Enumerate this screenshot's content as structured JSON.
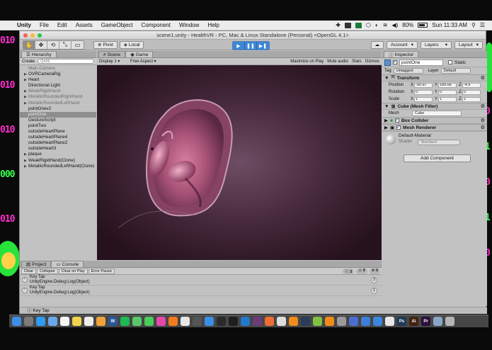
{
  "wallpaper": {
    "left_digits": [
      "010",
      "010",
      "010",
      "000",
      "010",
      "010"
    ],
    "right_digits": [
      "0",
      "1",
      "0",
      "1",
      "0"
    ],
    "left_colors": [
      "#ff2fd0",
      "#ff2fd0",
      "#ff2fd0",
      "#39ff4b",
      "#ff2fd0",
      "#ff2fd0"
    ]
  },
  "menubar": {
    "apple": "",
    "items": [
      "Unity",
      "File",
      "Edit",
      "Assets",
      "GameObject",
      "Component",
      "Window",
      "Help"
    ],
    "battery": "80%",
    "clock": "Sun 11:33 AM"
  },
  "window": {
    "title": "scene1.unity - HealthVR - PC, Mac & Linux Standalone (Personal) <OpenGL 4.1>"
  },
  "toolbar": {
    "tools": [
      "✋",
      "✥",
      "⟲",
      "⤡",
      "▭"
    ],
    "pivot": "Pivot",
    "local": "Local",
    "play": "▶",
    "pause": "❚❚",
    "step": "▶❚",
    "cloud": "☁",
    "account": "Account",
    "layers": "Layers",
    "layout": "Layout"
  },
  "hierarchy": {
    "tab": "Hierarchy",
    "create": "Create",
    "search_placeholder": "Q▾All",
    "items": [
      {
        "label": "Main Camera",
        "dim": true,
        "arrow": ""
      },
      {
        "label": "OVRCameraRig",
        "dim": false,
        "arrow": "▶"
      },
      {
        "label": "Heart",
        "dim": false,
        "arrow": "▶"
      },
      {
        "label": "Directional Light",
        "dim": false,
        "arrow": ""
      },
      {
        "label": "WeakRigidHand",
        "dim": true,
        "arrow": "▶"
      },
      {
        "label": "MetallicRoundedRightHand",
        "dim": true,
        "arrow": "▶"
      },
      {
        "label": "MetallicRoundedLeftHand",
        "dim": true,
        "arrow": "▶"
      },
      {
        "label": "pointOnev2",
        "dim": false,
        "arrow": ""
      },
      {
        "label": "pointOne",
        "dim": false,
        "arrow": "",
        "selected": true
      },
      {
        "label": "GestureScript",
        "dim": false,
        "arrow": ""
      },
      {
        "label": "pointTwo",
        "dim": false,
        "arrow": ""
      },
      {
        "label": "outsideHeartPlane",
        "dim": false,
        "arrow": ""
      },
      {
        "label": "outsideHeartPlane4",
        "dim": false,
        "arrow": ""
      },
      {
        "label": "outsideHeartPlane2",
        "dim": false,
        "arrow": ""
      },
      {
        "label": "outsideHeart3",
        "dim": false,
        "arrow": ""
      },
      {
        "label": "plaque",
        "dim": false,
        "arrow": "▶"
      },
      {
        "label": "WeakRigidHand(Clone)",
        "dim": false,
        "arrow": "▶"
      },
      {
        "label": "MetallicRoundedLeftHand(Clone)",
        "dim": false,
        "arrow": "▶"
      }
    ]
  },
  "view": {
    "tab_scene": "Scene",
    "tab_game": "Game",
    "display": "Display 1",
    "aspect": "Free Aspect",
    "maximize": "Maximize on Play",
    "mute": "Mute audio",
    "stats": "Stats",
    "gizmos": "Gizmos"
  },
  "inspector": {
    "tab": "Inspector",
    "name": "pointOne",
    "static": "Static",
    "tag_label": "Tag",
    "tag": "Untagged",
    "layer_label": "Layer",
    "layer": "Default",
    "transform": {
      "title": "Transform",
      "rows": [
        {
          "label": "Position",
          "x": "-90.97",
          "y": "189.66",
          "z": "-4.9"
        },
        {
          "label": "Rotation",
          "x": "0",
          "y": "0",
          "z": "0"
        },
        {
          "label": "Scale",
          "x": "1",
          "y": "1",
          "z": "1"
        }
      ]
    },
    "mesh_filter": {
      "title": "Cube (Mesh Filter)",
      "mesh_label": "Mesh",
      "mesh": "Cube"
    },
    "box_collider": "Box Collider",
    "mesh_renderer": "Mesh Renderer",
    "material": {
      "name": "Default-Material",
      "shader_label": "Shader",
      "shader": "Standard"
    },
    "add_component": "Add Component"
  },
  "console": {
    "tab_project": "Project",
    "tab_console": "Console",
    "buttons": [
      "Clear",
      "Collapse",
      "Clear on Play",
      "Error Pause"
    ],
    "counts": [
      "3",
      "0",
      "0"
    ],
    "logs": [
      {
        "line1": "Key Tap",
        "line2": "UnityEngine.Debug:Log(Object)",
        "count": "3"
      },
      {
        "line1": "Key Tap",
        "line2": "UnityEngine.Debug:Log(Object)",
        "count": "1"
      }
    ],
    "status": "Key Tap"
  },
  "dock": {
    "icons": [
      {
        "name": "finder-icon",
        "color": "#3d8ee8"
      },
      {
        "name": "launchpad-icon",
        "color": "#7c7c7c"
      },
      {
        "name": "safari-icon",
        "color": "#2e9bf0"
      },
      {
        "name": "mail-icon",
        "color": "#6aa7e8"
      },
      {
        "name": "calendar-icon",
        "color": "#f5f5f5"
      },
      {
        "name": "notes-icon",
        "color": "#f2d34a"
      },
      {
        "name": "reminders-icon",
        "color": "#ededed"
      },
      {
        "name": "photos-icon",
        "color": "#f0a23a"
      },
      {
        "name": "word-icon",
        "color": "#2b5797"
      },
      {
        "name": "spotify-icon",
        "color": "#1db954"
      },
      {
        "name": "messages-icon",
        "color": "#58c86a"
      },
      {
        "name": "facetime-icon",
        "color": "#4ccb5a"
      },
      {
        "name": "itunes-icon",
        "color": "#e24aa8"
      },
      {
        "name": "firefox-icon",
        "color": "#f07a1d"
      },
      {
        "name": "chrome-icon",
        "color": "#e6e6e6"
      },
      {
        "name": "sublime-icon",
        "color": "#555555"
      },
      {
        "name": "appstore-icon",
        "color": "#3a8fe6"
      },
      {
        "name": "github-icon",
        "color": "#2b2b2b"
      },
      {
        "name": "terminal-icon",
        "color": "#1e1e1e"
      },
      {
        "name": "vscode-icon",
        "color": "#2478cc"
      },
      {
        "name": "slack-icon",
        "color": "#6a3c7a"
      },
      {
        "name": "postman-icon",
        "color": "#ef6c35"
      },
      {
        "name": "unity-icon",
        "color": "#dddddd"
      },
      {
        "name": "blender-icon",
        "color": "#f08b1c"
      },
      {
        "name": "steam-icon",
        "color": "#2a3c5a"
      },
      {
        "name": "android-icon",
        "color": "#7fc243"
      },
      {
        "name": "vlc-icon",
        "color": "#f28a1a"
      },
      {
        "name": "oculus-icon",
        "color": "#9a9a9a"
      },
      {
        "name": "finder2-icon",
        "color": "#4a6ecf"
      },
      {
        "name": "xcode-icon",
        "color": "#3c7fd8"
      },
      {
        "name": "dropbox-icon",
        "color": "#3a86e0"
      },
      {
        "name": "chrome2-icon",
        "color": "#e8e8e8"
      },
      {
        "name": "photoshop-icon",
        "color": "#1f3a5a"
      },
      {
        "name": "illustrator-icon",
        "color": "#442210"
      },
      {
        "name": "premiere-icon",
        "color": "#2a0f3c"
      },
      {
        "name": "folder-icon",
        "color": "#8aa6c6"
      },
      {
        "name": "trash-icon",
        "color": "#b5b5b5"
      }
    ],
    "labels": {
      "photoshop-icon": "Ps",
      "illustrator-icon": "Ai",
      "premiere-icon": "Pr",
      "word-icon": "W"
    }
  }
}
